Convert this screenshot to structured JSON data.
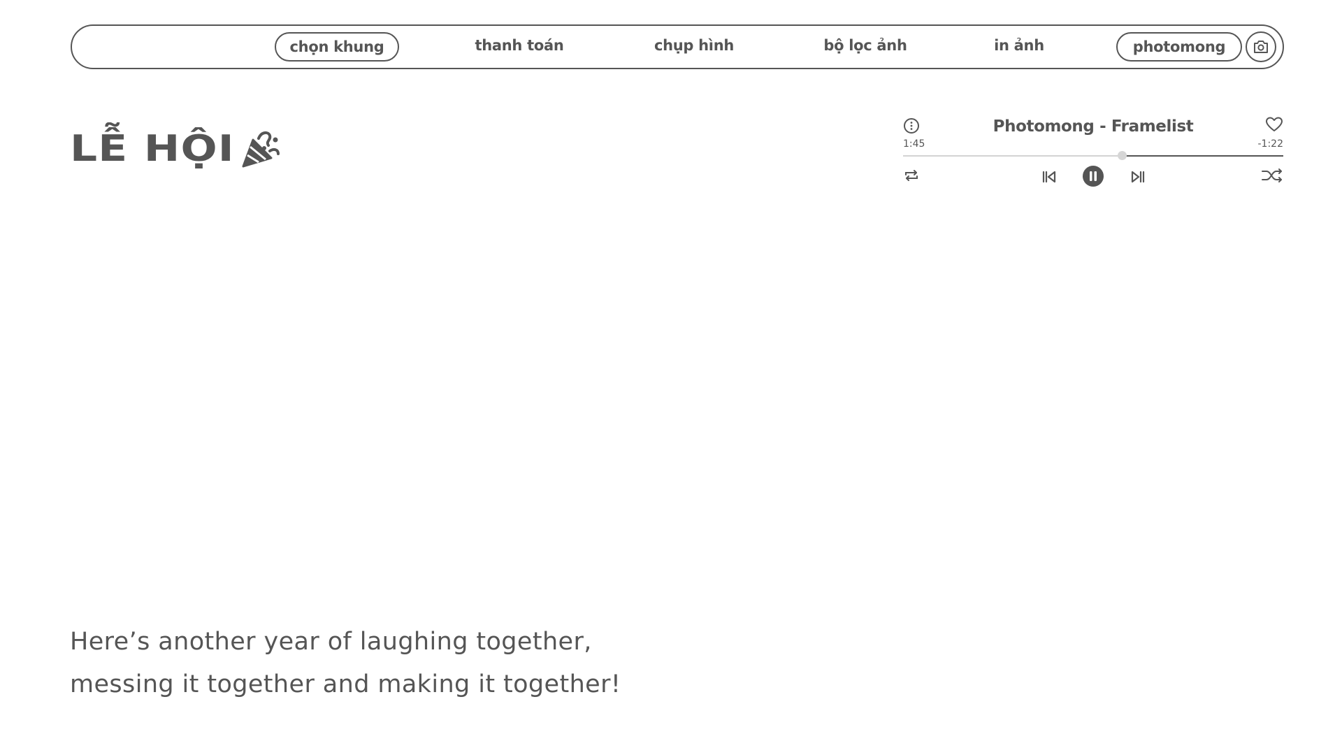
{
  "nav": {
    "items": [
      {
        "label": "chọn khung",
        "boxed": true
      },
      {
        "label": "thanh toán",
        "boxed": false
      },
      {
        "label": "chụp hình",
        "boxed": false
      },
      {
        "label": "bộ lọc ảnh",
        "boxed": false
      },
      {
        "label": "in ảnh",
        "boxed": false
      },
      {
        "label": "photomong",
        "boxed": true
      }
    ],
    "camera_icon": "camera-icon"
  },
  "heading": {
    "title": "LỄ HỘI",
    "icon": "party-popper-icon"
  },
  "player": {
    "track_title": "Photomong - Framelist",
    "elapsed": "1:45",
    "remaining": "-1:22",
    "progress": 0.575,
    "icons": {
      "info": "info-icon",
      "favorite": "heart-icon",
      "repeat": "repeat-icon",
      "previous": "skip-previous-icon",
      "play_state": "pause-icon",
      "next": "skip-next-icon",
      "shuffle": "shuffle-icon"
    }
  },
  "tagline": {
    "line1": "Here’s another year of laughing together,",
    "line2": "messing it together and making it together!"
  },
  "colors": {
    "primary": "#555555",
    "track_fill": "#d3d3d3",
    "background": "#ffffff"
  }
}
